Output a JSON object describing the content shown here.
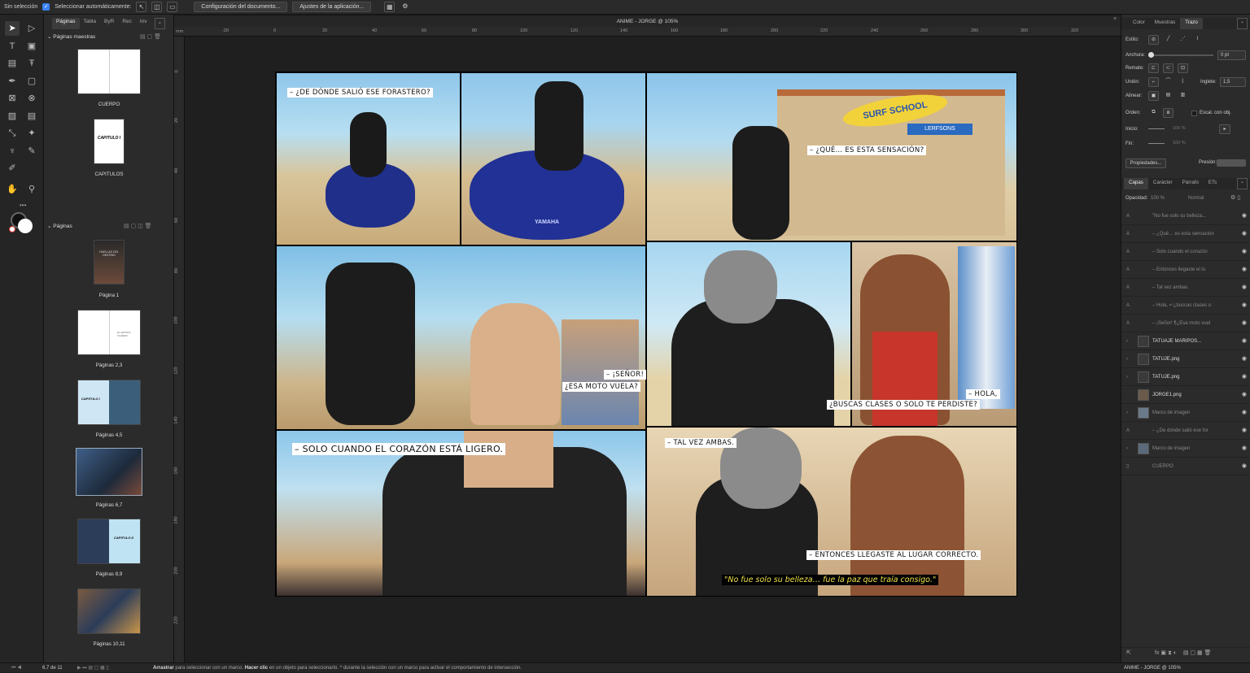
{
  "topbar": {
    "selection": "Sin selección",
    "auto_select": "Seleccionar automáticamente:",
    "doc_setup": "Configuración del documento...",
    "app_settings": "Ajustes de la aplicación..."
  },
  "document": {
    "title": "ANIME - JORGE @ 105%",
    "unit": "mm"
  },
  "pages_panel": {
    "tabs": [
      "Páginas",
      "Tabla",
      "ByR",
      "Rec",
      "Inv"
    ],
    "masters_header": "Páginas maestras",
    "masters": [
      {
        "label": "CUERPO"
      },
      {
        "label": "CAPITULOS",
        "thumb_text": "CAPITULO I"
      }
    ],
    "pages_header": "Páginas",
    "pages": [
      "Página 1",
      "Páginas 2,3",
      "Páginas 4,5",
      "Páginas 6,7",
      "Páginas 8,9",
      "Páginas 10,11"
    ],
    "thumb_texts": {
      "p1": "HUELLAS DEL DESTINO",
      "p23": "EL ARTISTA VIAJERO",
      "p45": "CAPITULO I",
      "p89": "CAPITULO II"
    }
  },
  "ruler": {
    "top": [
      "-20",
      "0",
      "20",
      "40",
      "60",
      "80",
      "100",
      "120",
      "140",
      "160",
      "180",
      "200",
      "220",
      "240",
      "260",
      "280",
      "300",
      "320"
    ],
    "left": [
      "0",
      "20",
      "40",
      "60",
      "80",
      "100",
      "120",
      "140",
      "160",
      "180",
      "200",
      "220"
    ]
  },
  "comic": {
    "bubbles": [
      "– ¿DE DÓNDE SALIÓ ESE FORASTERO?",
      "– ¿QUÉ… ES ESTA SENSACIÓN?",
      "– ¡SEÑOR!",
      "¿ESA MOTO VUELA?",
      "– SOLO CUANDO EL CORAZÓN ESTÁ LIGERO.",
      "– HOLA,",
      "¿BUSCAS CLASES O SOLO TE PERDISTE?",
      "– TAL VEZ AMBAS.",
      "– ENTONCES LLEGASTE AL LUGAR CORRECTO."
    ],
    "caption": "\"No fue solo su belleza… fue la paz que traía consigo.\"",
    "signs": {
      "surf": "SURF SCHOOL",
      "shop": "LERFSONS",
      "moto": "YAMAHA"
    }
  },
  "right_panel": {
    "tabs": [
      "Color",
      "Muestras",
      "Trazo"
    ],
    "stroke": {
      "style": "Estilo:",
      "width": "Anchura:",
      "width_value": "0 pt",
      "cap": "Remate:",
      "join": "Unión:",
      "miter": "Inglete:",
      "miter_value": "1,5",
      "align": "Alinear:",
      "order": "Orden:",
      "scale": "Escal. con obj.",
      "start": "Inicio:",
      "end": "Fin:",
      "start_pct": "100 %",
      "end_pct": "100 %",
      "properties": "Propiedades...",
      "pressure": "Presión:"
    },
    "layer_tabs": [
      "Capas",
      "Carácter",
      "Párrafo",
      "ETs"
    ],
    "opacity_label": "Opacidad:",
    "opacity_value": "100 %",
    "blend": "Normal",
    "layers": [
      {
        "name": "\"No fue solo su belleza...",
        "bright": false
      },
      {
        "name": "– ¿Qué… es esta sensación",
        "bright": false
      },
      {
        "name": "– Solo cuando el corazón",
        "bright": false
      },
      {
        "name": "– Entonces llegaste el lu",
        "bright": false
      },
      {
        "name": "– Tal vez ambas.",
        "bright": false
      },
      {
        "name": "– Hola, ↵¿buscas clases o",
        "bright": false
      },
      {
        "name": "– ¡Señor! ¶¿Esa moto vuel",
        "bright": false
      },
      {
        "name": "TATUAJE MARIPOS...",
        "bright": true
      },
      {
        "name": "TATUJE.png",
        "bright": true
      },
      {
        "name": "TATUJE.png",
        "bright": true
      },
      {
        "name": "JORGE1.png",
        "bright": true
      },
      {
        "name": "Marco de imagen",
        "bright": false
      },
      {
        "name": "– ¿De dónde salió ese for",
        "bright": false
      },
      {
        "name": "Marco de imagen",
        "bright": false
      },
      {
        "name": "CUERPO",
        "bright": false
      }
    ],
    "bottom_title": "ANIME - JORGE @ 105%"
  },
  "status": {
    "page": "6,7 de 11",
    "hint_bold1": "Arrastrar",
    "hint1": " para seleccionar con un marco. ",
    "hint_bold2": "Hacer clic",
    "hint2": " en un objeto para seleccionarlo. ^ durante la selección con un marco para activar el comportamiento de intersección."
  },
  "colors": {
    "accent": "#3b82f6",
    "caption_text": "#f0e24a",
    "panel_bg": "#2b2b2b"
  }
}
